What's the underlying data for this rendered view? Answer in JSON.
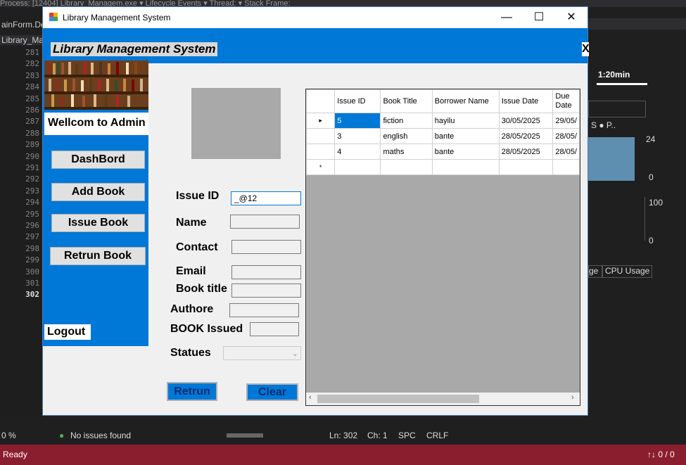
{
  "vs": {
    "top_text": "Process: [12404] Library_Managem.exe   ▾  Lifecycle Events ▾  Thread:                                  ▾  Stack Frame:",
    "tab1": "ainForm.De",
    "tab2": "Library_Ma",
    "line_numbers": [
      "281",
      "282",
      "283",
      "284",
      "285",
      "286",
      "287",
      "288",
      "289",
      "290",
      "291",
      "292",
      "293",
      "294",
      "295",
      "296",
      "297",
      "298",
      "299",
      "300",
      "301",
      "302"
    ],
    "zoom": "0 %",
    "issues": "No issues found",
    "ln": "Ln: 302",
    "ch": "Ch: 1",
    "spc": "SPC",
    "crlf": "CRLF",
    "ready": "Ready",
    "right_time": "1:20min",
    "right_val1": "24",
    "right_val2": "0",
    "right_val3": "100",
    "right_val4": "0",
    "right_tab1": "ge",
    "right_tab2": "CPU Usage",
    "right_legend": "S  ● P..",
    "bottom_right": "↑↓ 0 / 0"
  },
  "window": {
    "title": "Library Management System",
    "header_title": "Library Management System",
    "header_close": "X"
  },
  "sidebar": {
    "welcome": "Wellcom to Admin",
    "buttons": [
      "DashBord",
      "Add Book",
      "Issue Book",
      "Retrun Book"
    ],
    "logout": "Logout"
  },
  "form": {
    "labels": {
      "issue_id": "Issue ID",
      "name": "Name",
      "contact": "Contact",
      "email": "Email",
      "book_title": "Book title",
      "authore": "Authore",
      "book_issued": "BOOK Issued",
      "statues": "Statues"
    },
    "issue_id_value": "_@12",
    "retrun_button": "Retrun",
    "clear_button": "Clear"
  },
  "grid": {
    "columns": [
      "Issue ID",
      "Book Title",
      "Borrower Name",
      "Issue Date",
      "Due Date"
    ],
    "rows": [
      [
        "5",
        "fiction",
        "hayilu",
        "30/05/2025",
        "29/05/"
      ],
      [
        "3",
        "english",
        "bante",
        "28/05/2025",
        "28/05/"
      ],
      [
        "4",
        "maths",
        "bante",
        "28/05/2025",
        "28/05/"
      ]
    ],
    "current_row_marker": "▸",
    "new_row_marker": "*"
  }
}
